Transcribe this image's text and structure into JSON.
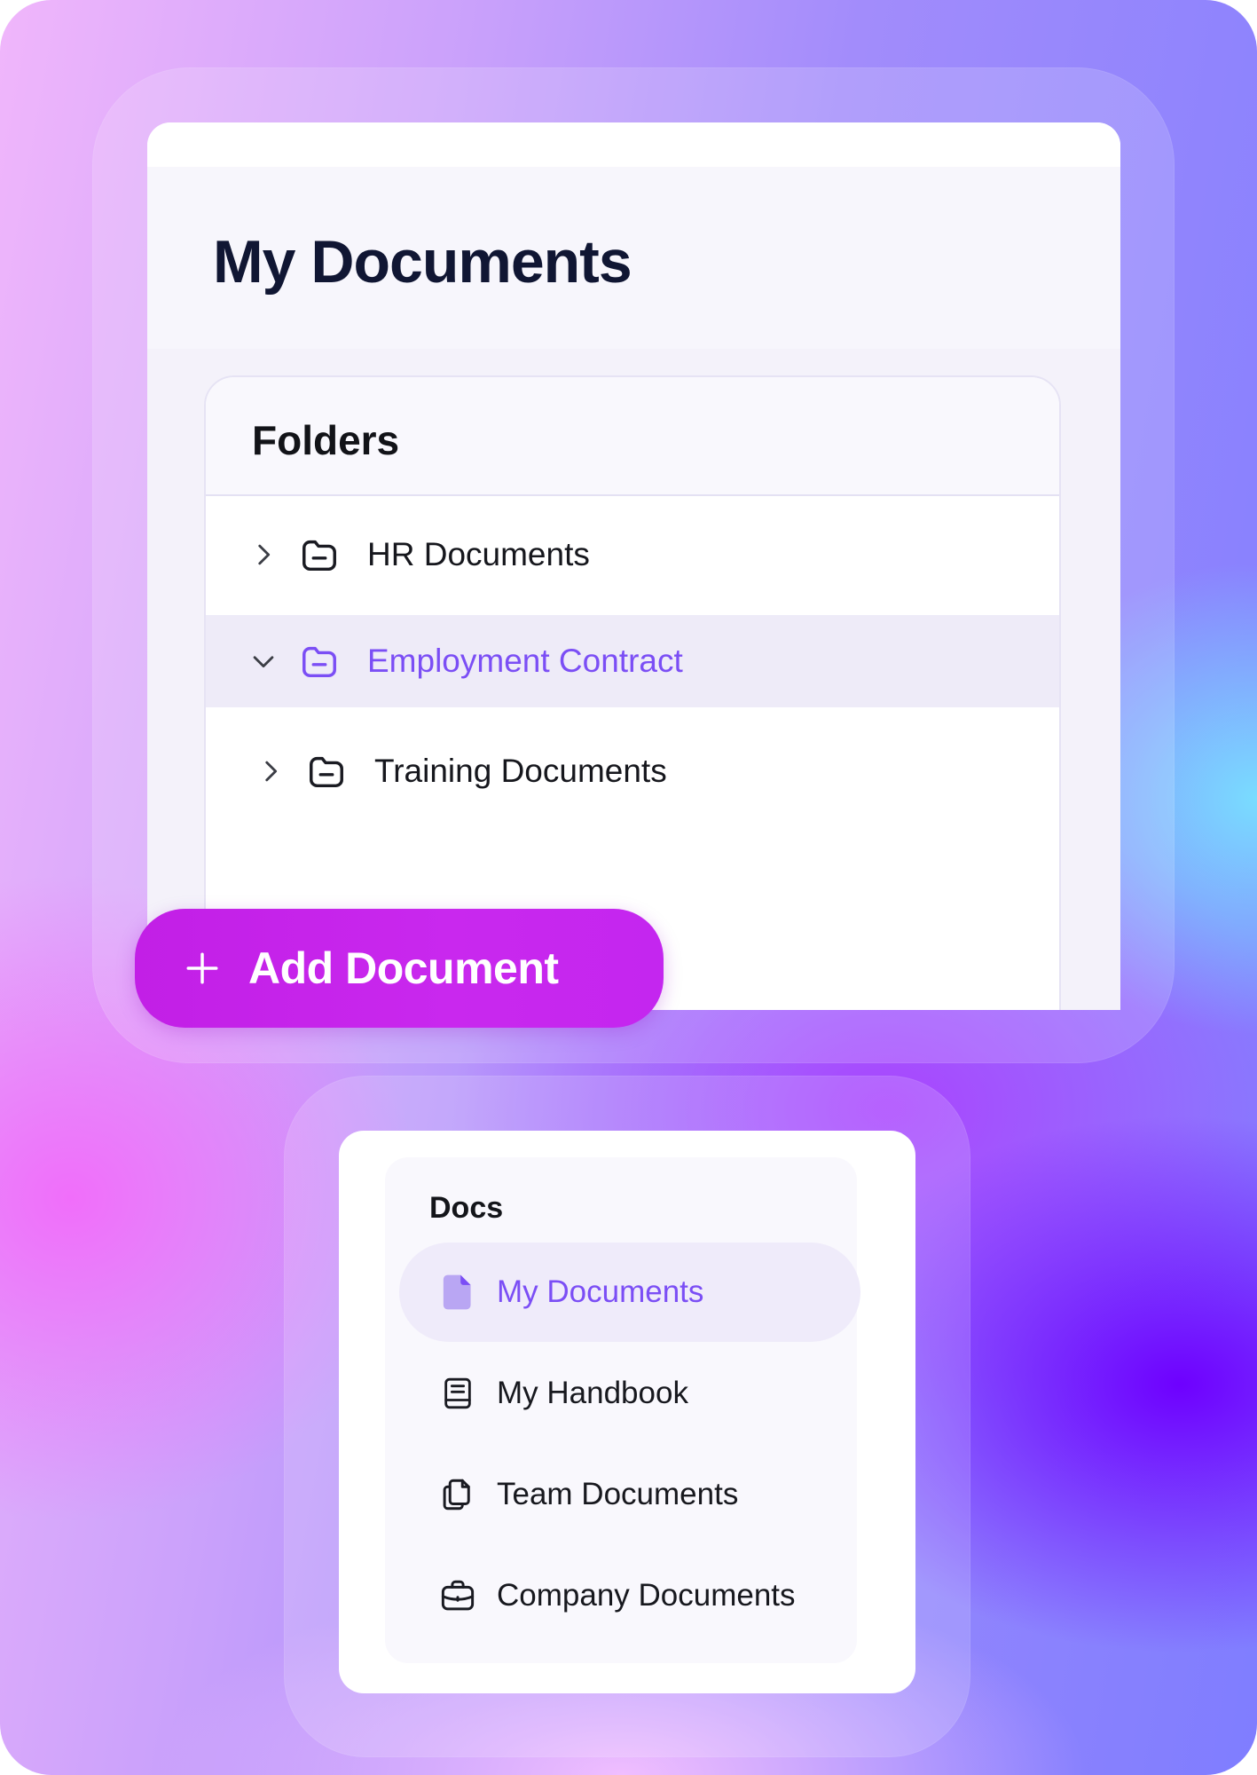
{
  "colors": {
    "accent": "#7b4ef5",
    "button": "#c426ef",
    "title": "#101633"
  },
  "main": {
    "title": "My Documents"
  },
  "folders": {
    "title": "Folders",
    "items": [
      {
        "label": "HR Documents",
        "expanded": false,
        "selected": false,
        "icon": "folder-icon"
      },
      {
        "label": "Employment Contract",
        "expanded": true,
        "selected": true,
        "icon": "folder-icon"
      },
      {
        "label": "Training Documents",
        "expanded": false,
        "selected": false,
        "icon": "folder-icon"
      }
    ]
  },
  "actions": {
    "add_document": "Add Document"
  },
  "docs_nav": {
    "title": "Docs",
    "items": [
      {
        "label": "My Documents",
        "active": true,
        "icon": "document-icon"
      },
      {
        "label": "My Handbook",
        "active": false,
        "icon": "handbook-icon"
      },
      {
        "label": "Team Documents",
        "active": false,
        "icon": "copy-documents-icon"
      },
      {
        "label": "Company Documents",
        "active": false,
        "icon": "briefcase-icon"
      }
    ]
  }
}
